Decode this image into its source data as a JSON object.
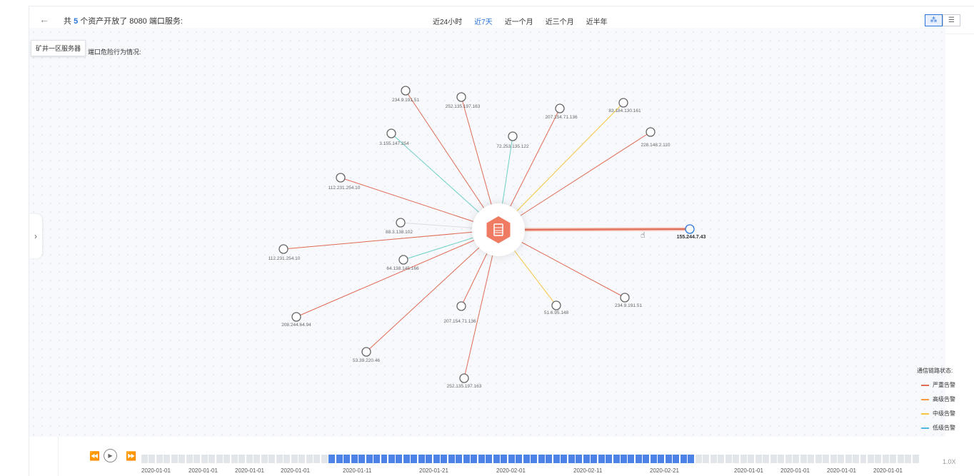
{
  "header": {
    "back_icon": "←",
    "title_prefix": "共",
    "title_count": "5",
    "title_suffix": "个资产开放了 8080 端口服务:",
    "ranges": [
      {
        "label": "近24小时",
        "active": false
      },
      {
        "label": "近7天",
        "active": true
      },
      {
        "label": "近一个月",
        "active": false
      },
      {
        "label": "近三个月",
        "active": false
      },
      {
        "label": "近半年",
        "active": false
      }
    ],
    "view_buttons": [
      {
        "name": "graph-view-button",
        "icon": "⁂",
        "active": true
      },
      {
        "name": "list-view-button",
        "icon": "☰",
        "active": false
      }
    ]
  },
  "sidebar": {
    "assets": [
      {
        "color": "#f07b63",
        "active": true
      },
      {
        "color": "#6fcfd6",
        "active": false
      },
      {
        "color": "#f59a1c",
        "active": false
      },
      {
        "color": "#f5c542",
        "active": false
      },
      {
        "color": "#f5c542",
        "active": false
      }
    ],
    "tooltip": "矿井一区服务器"
  },
  "canvas": {
    "subtitle": "端口危险行为情况:",
    "expand_icon": "›",
    "center_icon": "server-icon",
    "center_color": "#f07b63",
    "nodes": [
      {
        "label": "234.9.191.51",
        "status": "severe"
      },
      {
        "label": "252.135.197.163",
        "status": "severe"
      },
      {
        "label": "207.154.71.136",
        "status": "severe"
      },
      {
        "label": "83.184.130.161",
        "status": "medium"
      },
      {
        "label": "228.148.2.110",
        "status": "severe"
      },
      {
        "label": "3.155.147.254",
        "status": "low"
      },
      {
        "label": "72.253.135.122",
        "status": "low"
      },
      {
        "label": "112.231.254.10",
        "status": "severe"
      },
      {
        "label": "88.3.138.102",
        "status": "none"
      },
      {
        "label": "155.244.7.43",
        "status": "severe",
        "selected": true
      },
      {
        "label": "112.231.254.10",
        "status": "severe"
      },
      {
        "label": "64.138.145.166",
        "status": "low"
      },
      {
        "label": "208.244.64.94",
        "status": "severe"
      },
      {
        "label": "207.154.71.136",
        "status": "severe"
      },
      {
        "label": "51.6.95.148",
        "status": "medium"
      },
      {
        "label": "234.9.191.51",
        "status": "severe"
      },
      {
        "label": "53.39.220.46",
        "status": "severe"
      },
      {
        "label": "252.135.197.163",
        "status": "severe"
      }
    ]
  },
  "legend": {
    "title": "通信链路状态:",
    "items": [
      {
        "label": "严重告警",
        "color": "#e06b55"
      },
      {
        "label": "高级告警",
        "color": "#f59a3c"
      },
      {
        "label": "中级告警",
        "color": "#f5c542"
      },
      {
        "label": "低级告警",
        "color": "#4fb8e6"
      }
    ]
  },
  "timeline": {
    "rewind_icon": "⏪",
    "play_icon": "▶",
    "forward_icon": "⏩",
    "dates": [
      "2020-01-01",
      "2020-01-01",
      "2020-01-01",
      "2020-01-01",
      "2020-01-11",
      "2020-01-21",
      "2020-02-01",
      "2020-02-11",
      "2020-02-21",
      "2020-01-01",
      "2020-01-01",
      "2020-01-01",
      "2020-01-01"
    ],
    "speed": "1.0X"
  },
  "colors": {
    "severe": "#e06b55",
    "medium": "#f5c542",
    "low": "#6fd0c6",
    "none": "#d8dde4",
    "accent": "#2a74d9"
  }
}
